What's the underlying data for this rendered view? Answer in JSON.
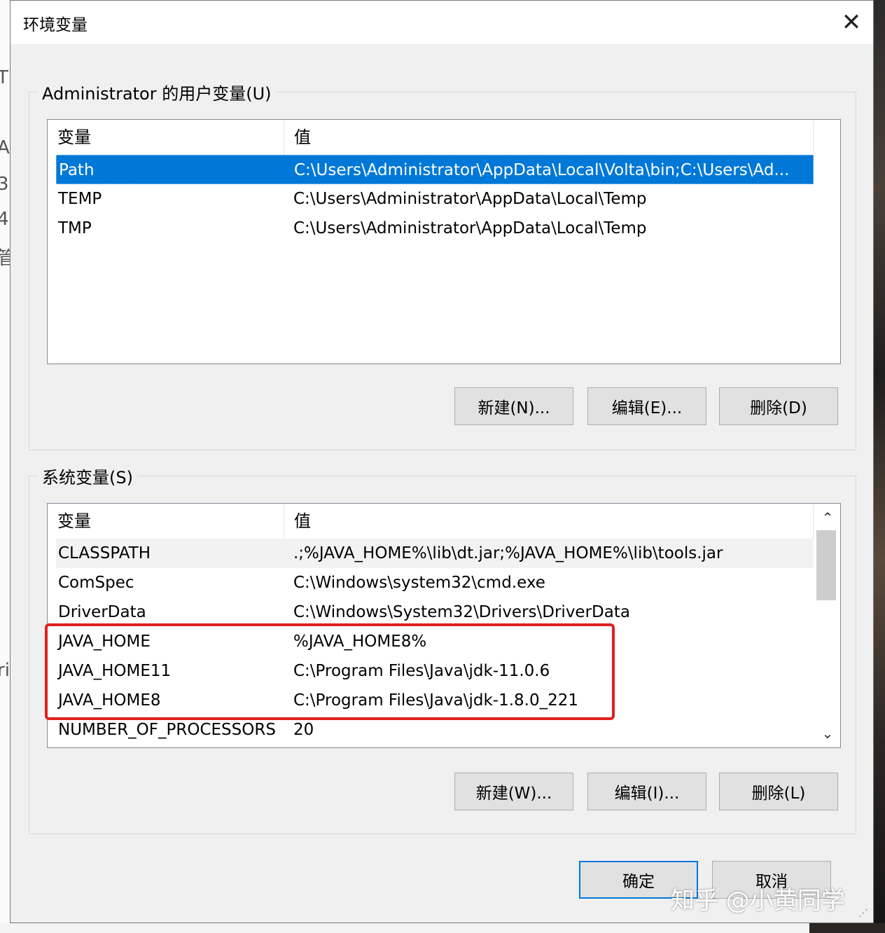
{
  "background": {
    "left_fragments": [
      "T",
      "A",
      "3",
      "4",
      "管",
      "ri"
    ]
  },
  "dialog": {
    "title": "环境变量",
    "close_glyph": "✕"
  },
  "user_vars": {
    "group_label": "Administrator 的用户变量(U)",
    "columns": [
      "变量",
      "值"
    ],
    "rows": [
      {
        "name": "Path",
        "value": "C:\\Users\\Administrator\\AppData\\Local\\Volta\\bin;C:\\Users\\Ad..."
      },
      {
        "name": "TEMP",
        "value": "C:\\Users\\Administrator\\AppData\\Local\\Temp"
      },
      {
        "name": "TMP",
        "value": "C:\\Users\\Administrator\\AppData\\Local\\Temp"
      }
    ],
    "selected_index": 0,
    "buttons": {
      "new": "新建(N)...",
      "edit": "编辑(E)...",
      "delete": "删除(D)"
    }
  },
  "system_vars": {
    "group_label": "系统变量(S)",
    "columns": [
      "变量",
      "值"
    ],
    "rows": [
      {
        "name": "CLASSPATH",
        "value": ".;%JAVA_HOME%\\lib\\dt.jar;%JAVA_HOME%\\lib\\tools.jar"
      },
      {
        "name": "ComSpec",
        "value": "C:\\Windows\\system32\\cmd.exe"
      },
      {
        "name": "DriverData",
        "value": "C:\\Windows\\System32\\Drivers\\DriverData"
      },
      {
        "name": "JAVA_HOME",
        "value": "%JAVA_HOME8%"
      },
      {
        "name": "JAVA_HOME11",
        "value": "C:\\Program Files\\Java\\jdk-11.0.6"
      },
      {
        "name": "JAVA_HOME8",
        "value": "C:\\Program Files\\Java\\jdk-1.8.0_221"
      },
      {
        "name": "NUMBER_OF_PROCESSORS",
        "value": "20"
      }
    ],
    "hover_index": 0,
    "buttons": {
      "new": "新建(W)...",
      "edit": "编辑(I)...",
      "delete": "删除(L)"
    },
    "scroll_up_glyph": "⌃",
    "scroll_down_glyph": "⌄"
  },
  "footer": {
    "ok": "确定",
    "cancel": "取消"
  },
  "watermark": "知乎 @小黄同学",
  "colors": {
    "selection": "#0078d7",
    "highlight_box": "#e02020"
  }
}
